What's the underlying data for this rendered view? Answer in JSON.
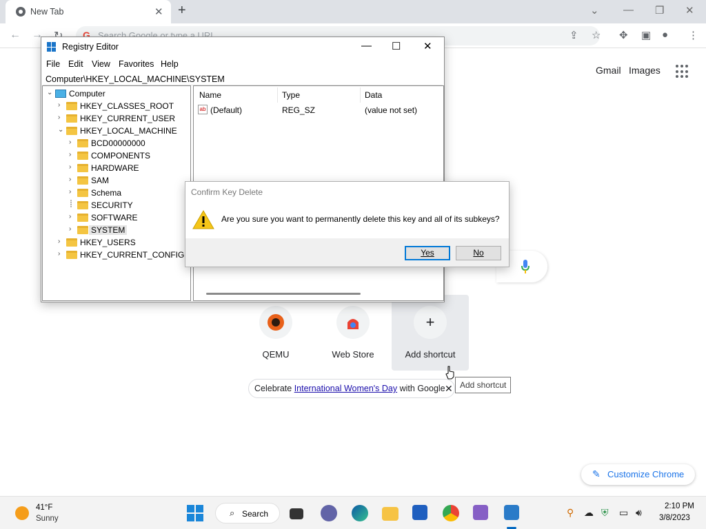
{
  "chrome": {
    "tab_title": "New Tab",
    "tab_close": "✕",
    "new_tab": "+",
    "omnibox_placeholder": "Search Google or type a URL",
    "header_links": {
      "gmail": "Gmail",
      "images": "Images"
    },
    "shortcuts": [
      {
        "label": "QEMU"
      },
      {
        "label": "Web Store"
      },
      {
        "label": "Add shortcut"
      }
    ],
    "promo": {
      "prefix": "Celebrate ",
      "link": "International Women's Day",
      "suffix": " with Google"
    },
    "tooltip": "Add shortcut",
    "customize_label": "Customize Chrome"
  },
  "regedit": {
    "title": "Registry Editor",
    "menu": [
      "File",
      "Edit",
      "View",
      "Favorites",
      "Help"
    ],
    "address": "Computer\\HKEY_LOCAL_MACHINE\\SYSTEM",
    "tree": {
      "root": "Computer",
      "hives": [
        "HKEY_CLASSES_ROOT",
        "HKEY_CURRENT_USER",
        "HKEY_LOCAL_MACHINE",
        "HKEY_USERS",
        "HKEY_CURRENT_CONFIG"
      ],
      "hklm_children": [
        "BCD00000000",
        "COMPONENTS",
        "HARDWARE",
        "SAM",
        "Schema",
        "SECURITY",
        "SOFTWARE",
        "SYSTEM"
      ],
      "selected": "SYSTEM"
    },
    "columns": [
      "Name",
      "Type",
      "Data"
    ],
    "values": [
      {
        "name": "(Default)",
        "type": "REG_SZ",
        "data": "(value not set)"
      }
    ]
  },
  "dialog": {
    "title": "Confirm Key Delete",
    "message": "Are you sure you want to permanently delete this key and all of its subkeys?",
    "yes": "Yes",
    "no": "No"
  },
  "taskbar": {
    "weather_temp": "41°F",
    "weather_condition": "Sunny",
    "search_label": "Search",
    "time": "2:10 PM",
    "date": "3/8/2023"
  },
  "colors": {
    "accent": "#0078d7",
    "chrome_link": "#1a73e8",
    "folder": "#f4c542",
    "warning": "#f5c518"
  }
}
